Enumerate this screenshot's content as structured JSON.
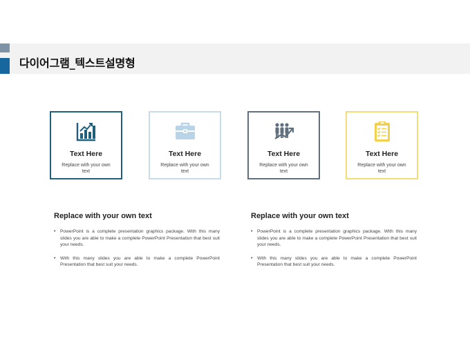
{
  "header": {
    "title": "다이어그램_텍스트설명형"
  },
  "colors": {
    "accent_light": "#7f93a6",
    "accent_dark": "#17679e",
    "card1": "#1f5f7a",
    "card2": "#c7dbe8",
    "card3": "#5f6f7e",
    "card4": "#f3dd79"
  },
  "cards": [
    {
      "icon": "bar-chart-icon",
      "title": "Text Here",
      "text": "Replace with your own text"
    },
    {
      "icon": "briefcase-icon",
      "title": "Text Here",
      "text": "Replace with your own text"
    },
    {
      "icon": "team-growth-icon",
      "title": "Text Here",
      "text": "Replace with your own text"
    },
    {
      "icon": "clipboard-checklist-icon",
      "title": "Text Here",
      "text": "Replace with your own text"
    }
  ],
  "sections": [
    {
      "title": "Replace with your own text",
      "bullets": [
        "PowerPoint is a complete presentation graphics package. With this many slides you are able to make a complete PowerPoint Presentation that best suit your needs.",
        "With this many slides you are able to make a complete PowerPoint Presentation that best suit your needs."
      ]
    },
    {
      "title": "Replace with your own text",
      "bullets": [
        "PowerPoint is a complete presentation graphics package. With this many slides you are able to make a complete PowerPoint Presentation that best suit your needs.",
        "With this many slides you are able to make a complete PowerPoint Presentation that best suit your needs."
      ]
    }
  ],
  "bullet_glyph": "•"
}
